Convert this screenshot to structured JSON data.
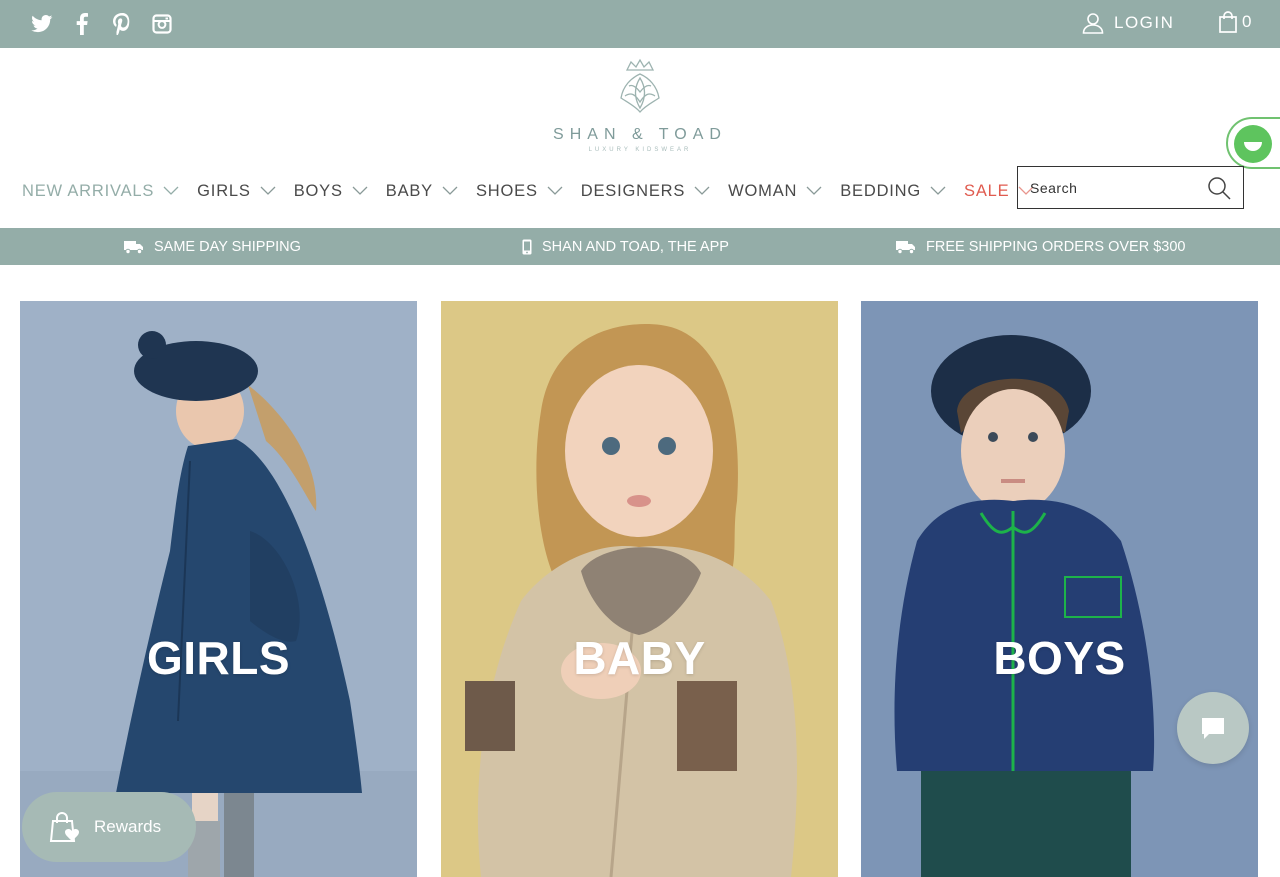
{
  "topbar": {
    "social": [
      {
        "icon": "twitter-icon"
      },
      {
        "icon": "facebook-icon"
      },
      {
        "icon": "pinterest-icon"
      },
      {
        "icon": "instagram-icon"
      }
    ],
    "login_label": "LOGIN",
    "cart_count": "0"
  },
  "logo": {
    "name": "SHAN & TOAD",
    "tagline": "LUXURY KIDSWEAR"
  },
  "nav": {
    "items": [
      {
        "label": "NEW ARRIVALS"
      },
      {
        "label": "GIRLS"
      },
      {
        "label": "BOYS"
      },
      {
        "label": "BABY"
      },
      {
        "label": "SHOES"
      },
      {
        "label": "DESIGNERS"
      },
      {
        "label": "WOMAN"
      },
      {
        "label": "BEDDING"
      },
      {
        "label": "SALE"
      }
    ]
  },
  "search": {
    "placeholder": "Search"
  },
  "banner": {
    "items": [
      {
        "label": "SAME DAY SHIPPING",
        "icon": "truck-icon"
      },
      {
        "label": "SHAN AND TOAD, THE APP",
        "icon": "mobile-phone-icon"
      },
      {
        "label": "FREE SHIPPING ORDERS OVER $300",
        "icon": "truck-icon"
      }
    ]
  },
  "tiles": [
    {
      "label": "GIRLS"
    },
    {
      "label": "BABY"
    },
    {
      "label": "BOYS"
    }
  ],
  "rewards": {
    "label": "Rewards"
  },
  "colors": {
    "topbar": "#94ada8",
    "sale": "#e05b4f",
    "widget_green": "#5ec45e",
    "tile_girls_bg": "#9fb1c7",
    "tile_baby_bg": "#dcc886",
    "tile_boys_bg": "#7d95b6"
  }
}
